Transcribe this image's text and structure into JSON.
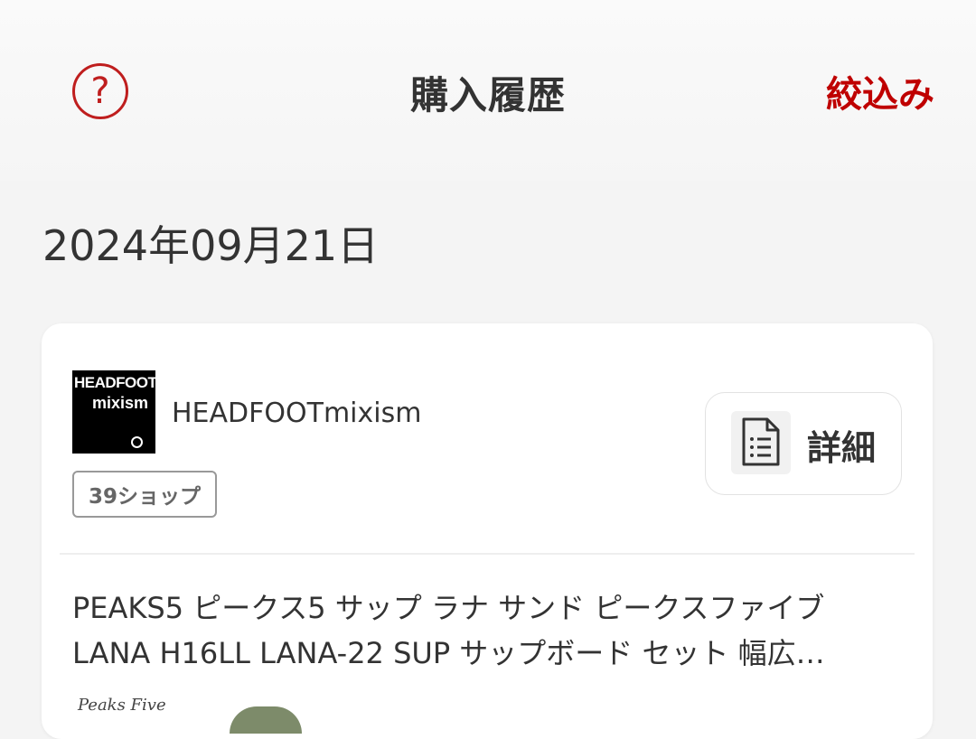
{
  "header": {
    "title": "購入履歴",
    "help_icon": "question-circle-icon",
    "help_glyph": "?",
    "filter_label": "絞込み"
  },
  "colors": {
    "accent": "#bf0000",
    "background": "#f4f4f4",
    "card": "#ffffff",
    "text": "#333333"
  },
  "orders": [
    {
      "date": "2024年09月21日",
      "shop": {
        "logo_line1": "HEADFOOT",
        "logo_line2": "mixism",
        "name": "HEADFOOTmixism",
        "badge": "39ショップ"
      },
      "detail_button": {
        "icon": "document-list-icon",
        "label": "詳細"
      },
      "product": {
        "title": "PEAKS5 ピークス5 サップ ラナ サンド ピークスファイブ LANA H16LL LANA-22 SUP サップボード セット 幅広…",
        "thumbnail_brand": "Peaks Five"
      }
    }
  ]
}
